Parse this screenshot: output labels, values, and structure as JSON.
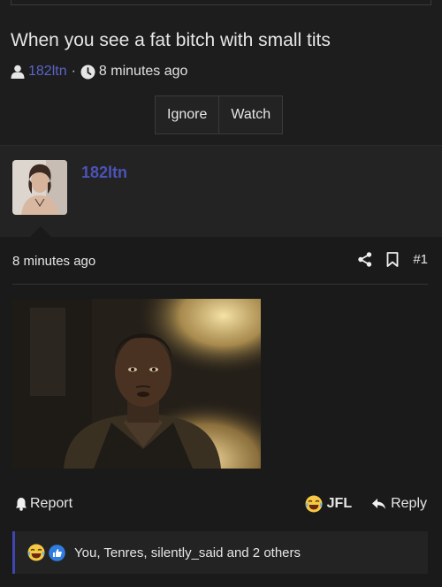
{
  "thread": {
    "title": "When you see a fat bitch with small tits",
    "author": "182ltn",
    "separator": "·",
    "time": "8 minutes ago"
  },
  "thread_actions": {
    "ignore_label": "Ignore",
    "watch_label": "Watch"
  },
  "post": {
    "author": "182ltn",
    "time": "8 minutes ago",
    "number": "#1",
    "report_label": "Report",
    "jfl_label": "JFL",
    "reply_label": "Reply",
    "reactions_text": "You, Tenres, silently_said and 2 others"
  },
  "icons": {
    "user": "user-icon",
    "clock": "clock-icon",
    "share": "share-icon",
    "bookmark": "bookmark-icon",
    "bell": "bell-icon",
    "laugh": "laughing-emoji-icon",
    "like": "thumbs-up-icon",
    "reply": "reply-arrow-icon"
  },
  "colors": {
    "link": "#5a64c8",
    "accent": "#3d46b2",
    "background": "#1d1d1d"
  }
}
